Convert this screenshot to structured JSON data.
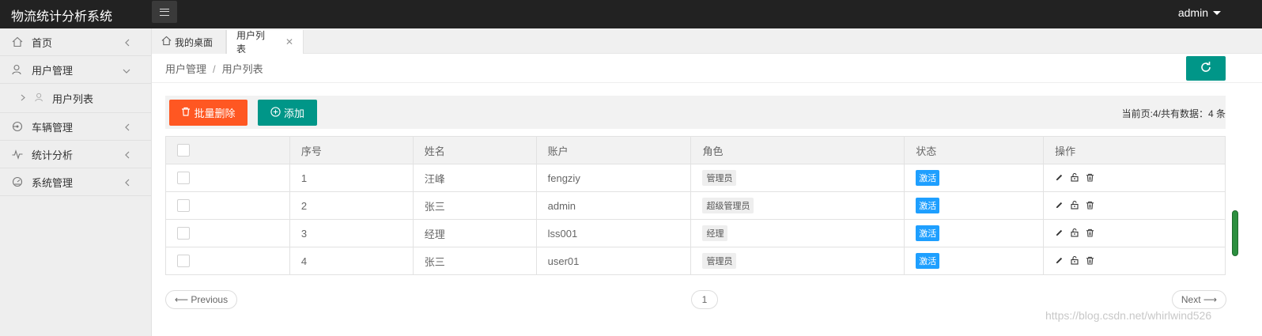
{
  "header": {
    "app_title": "物流统计分析系统",
    "user_label": "admin"
  },
  "sidebar": {
    "items": [
      {
        "label": "首页",
        "icon": "home-icon"
      },
      {
        "label": "用户管理",
        "icon": "user-icon",
        "expanded": true
      },
      {
        "label": "车辆管理",
        "icon": "car-icon"
      },
      {
        "label": "统计分析",
        "icon": "chart-icon"
      },
      {
        "label": "系统管理",
        "icon": "gauge-icon"
      }
    ],
    "sub_items": [
      {
        "label": "用户列表"
      }
    ]
  },
  "tabs": [
    {
      "label": "我的桌面",
      "icon": "home-icon"
    },
    {
      "label": "用户列表",
      "active": true,
      "closable": true
    }
  ],
  "breadcrumb": {
    "parent": "用户管理",
    "separator": "/",
    "current": "用户列表"
  },
  "toolbar": {
    "batch_delete_label": "批量删除",
    "add_label": "添加",
    "page_info": "当前页:4/共有数据：4 条"
  },
  "table": {
    "columns": [
      "序号",
      "姓名",
      "账户",
      "角色",
      "状态",
      "操作"
    ],
    "rows": [
      {
        "id": "1",
        "name": "汪峰",
        "account": "fengziy",
        "role": "管理员",
        "status": "激活"
      },
      {
        "id": "2",
        "name": "张三",
        "account": "admin",
        "role": "超级管理员",
        "status": "激活"
      },
      {
        "id": "3",
        "name": "经理",
        "account": "lss001",
        "role": "经理",
        "status": "激活"
      },
      {
        "id": "4",
        "name": "张三",
        "account": "user01",
        "role": "管理员",
        "status": "激活"
      }
    ]
  },
  "pagination": {
    "prev_label": "⟵ Previous",
    "current_page": "1",
    "next_label": "Next ⟶"
  },
  "watermark": "https://blog.csdn.net/whirlwind526",
  "colors": {
    "accent": "#009688",
    "danger": "#ff5722",
    "status": "#1e9fff",
    "header_bg": "#222222"
  }
}
